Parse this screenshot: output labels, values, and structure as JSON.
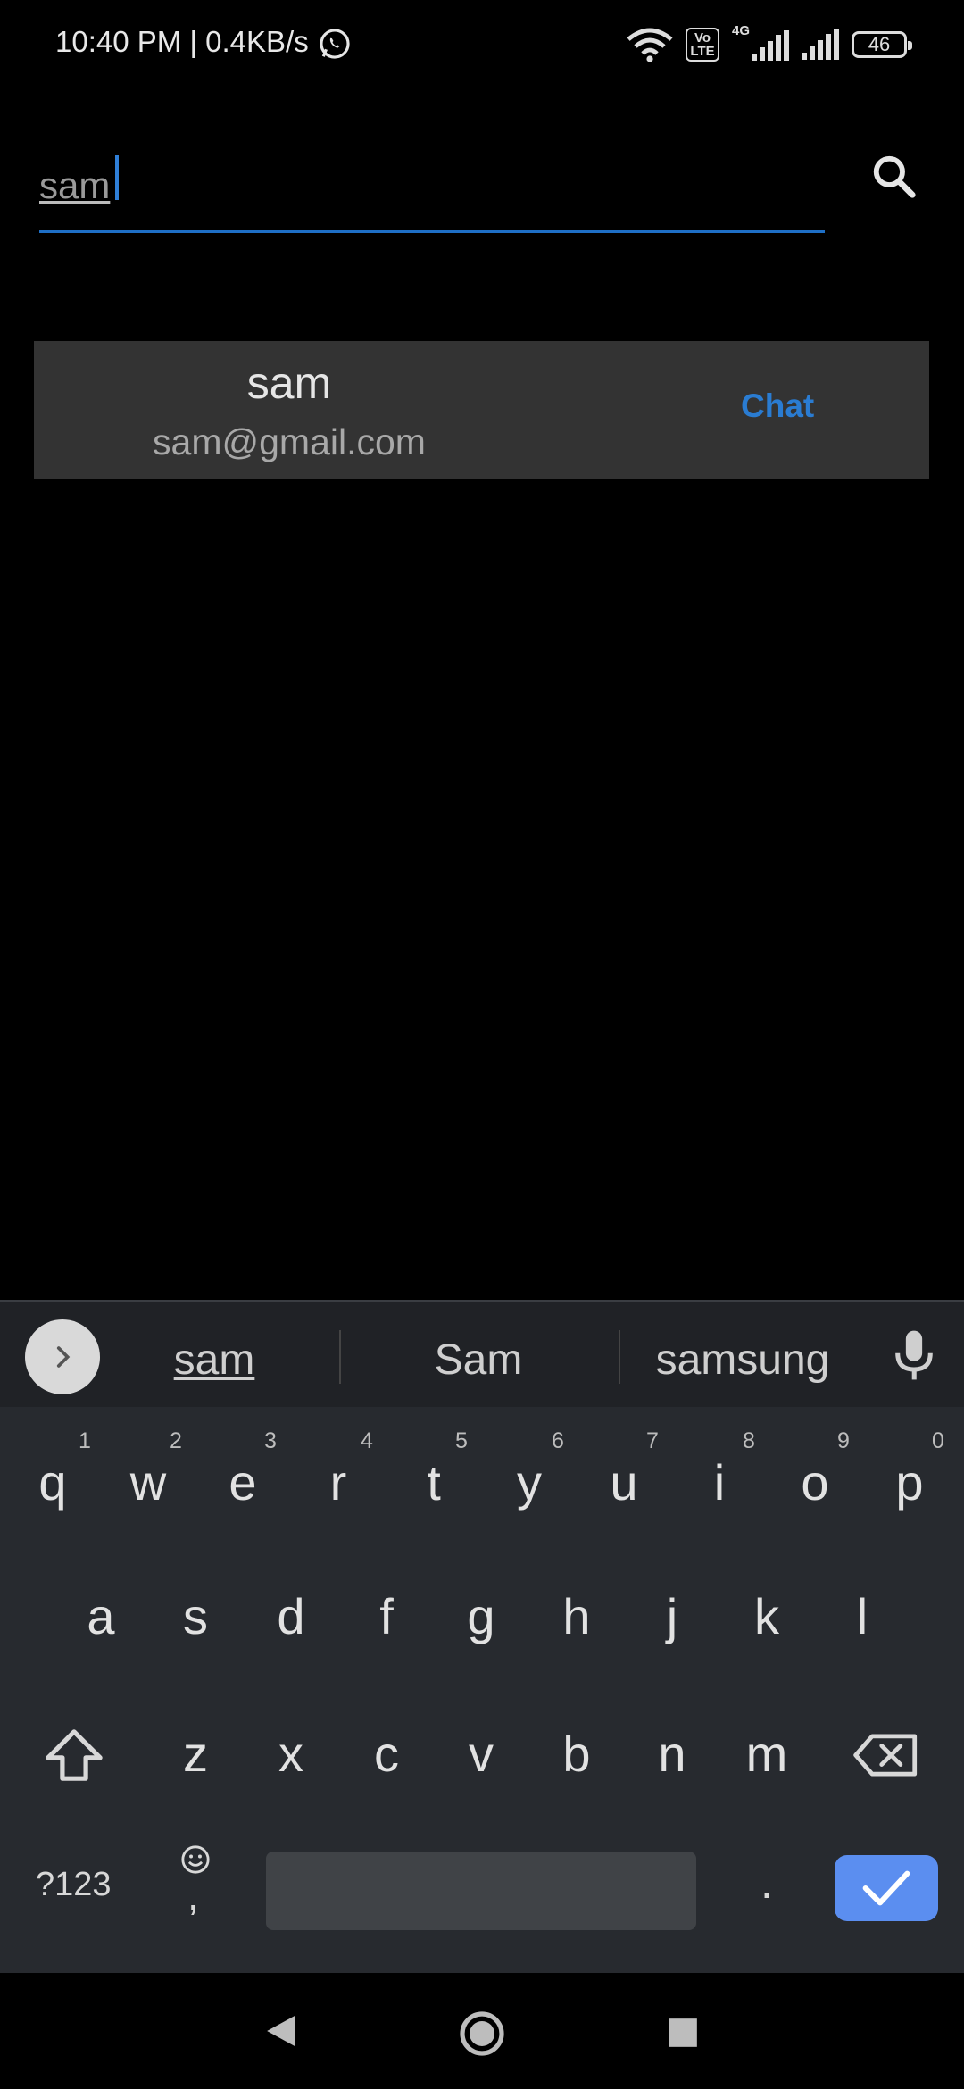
{
  "status_bar": {
    "time_speed": "10:40 PM | 0.4KB/s",
    "volte": "Vo LTE",
    "network": "4G",
    "battery": "46"
  },
  "search": {
    "value": "sam",
    "icon": "search-icon"
  },
  "result": {
    "name": "sam",
    "email": "sam@gmail.com",
    "action": "Chat",
    "action_color": "#2a7cd2"
  },
  "keyboard": {
    "suggestions": [
      "sam",
      "Sam",
      "samsung"
    ],
    "row1": [
      "q",
      "w",
      "e",
      "r",
      "t",
      "y",
      "u",
      "i",
      "o",
      "p"
    ],
    "row1_hints": [
      "1",
      "2",
      "3",
      "4",
      "5",
      "6",
      "7",
      "8",
      "9",
      "0"
    ],
    "row2": [
      "a",
      "s",
      "d",
      "f",
      "g",
      "h",
      "j",
      "k",
      "l"
    ],
    "row3": [
      "z",
      "x",
      "c",
      "v",
      "b",
      "n",
      "m"
    ],
    "symbols_label": "?123",
    "comma": ",",
    "period": ".",
    "enter_color": "#5b8ef0"
  }
}
